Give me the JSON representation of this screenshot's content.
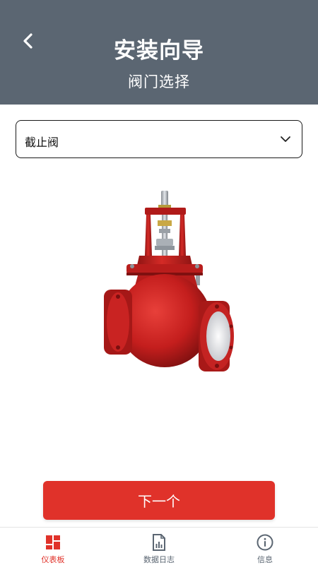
{
  "header": {
    "title": "安装向导",
    "subtitle": "阀门选择",
    "back_icon": "chevron-left-icon",
    "background": "#5b6672"
  },
  "valve_select": {
    "selected": "截止阀",
    "icon": "chevron-down-icon"
  },
  "product_image": {
    "type": "globe-valve",
    "color": "#c8201f"
  },
  "actions": {
    "next_label": "下一个",
    "accent": "#e0322a"
  },
  "tabbar": {
    "items": [
      {
        "label": "仪表板",
        "icon": "dashboard-icon",
        "active": true
      },
      {
        "label": "数据日志",
        "icon": "data-log-icon",
        "active": false
      },
      {
        "label": "信息",
        "icon": "info-icon",
        "active": false
      }
    ]
  }
}
